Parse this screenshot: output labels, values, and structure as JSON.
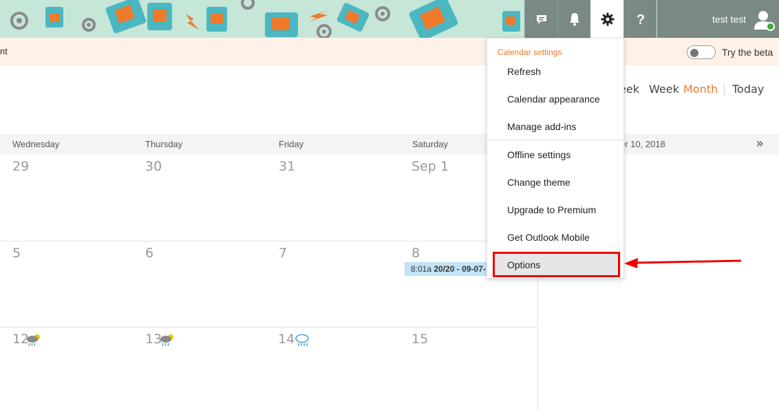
{
  "header": {
    "user_name": "test test",
    "icons": [
      "chat-icon",
      "bell-icon",
      "gear-icon",
      "help-icon",
      "avatar-icon"
    ]
  },
  "notice": {
    "text_fragment": "nt",
    "beta_label": "Try the beta"
  },
  "views": {
    "week_partial": "eek",
    "week": "Week",
    "month": "Month",
    "today": "Today",
    "active": "Month"
  },
  "day_headers": [
    "Wednesday",
    "Thursday",
    "Friday",
    "Saturday"
  ],
  "side_panel": {
    "date_fragment": "er 10, 2018",
    "chevron": "»"
  },
  "weeks": [
    {
      "days": [
        "29",
        "30",
        "31",
        "Sep 1"
      ]
    },
    {
      "days": [
        "5",
        "6",
        "7",
        "8"
      ]
    },
    {
      "days": [
        "12",
        "13",
        "14",
        "15"
      ],
      "weather": [
        "rain-sun-icon",
        "rain-sun-icon",
        "rain-icon",
        ""
      ]
    }
  ],
  "event": {
    "time": "8:01a",
    "title": "20/20 - 09-07-"
  },
  "settings_menu": {
    "title": "Calendar settings",
    "items": [
      "Refresh",
      "Calendar appearance",
      "Manage add-ins",
      "Offline settings",
      "Change theme",
      "Upgrade to Premium",
      "Get Outlook Mobile",
      "Options"
    ],
    "highlighted": "Options"
  },
  "colors": {
    "accent": "#e8782a",
    "header_bg": "#c6e6d8",
    "notice_bg": "#fdf1e8",
    "event_bg": "#c2e4f6",
    "annotation": "#ee0000"
  }
}
